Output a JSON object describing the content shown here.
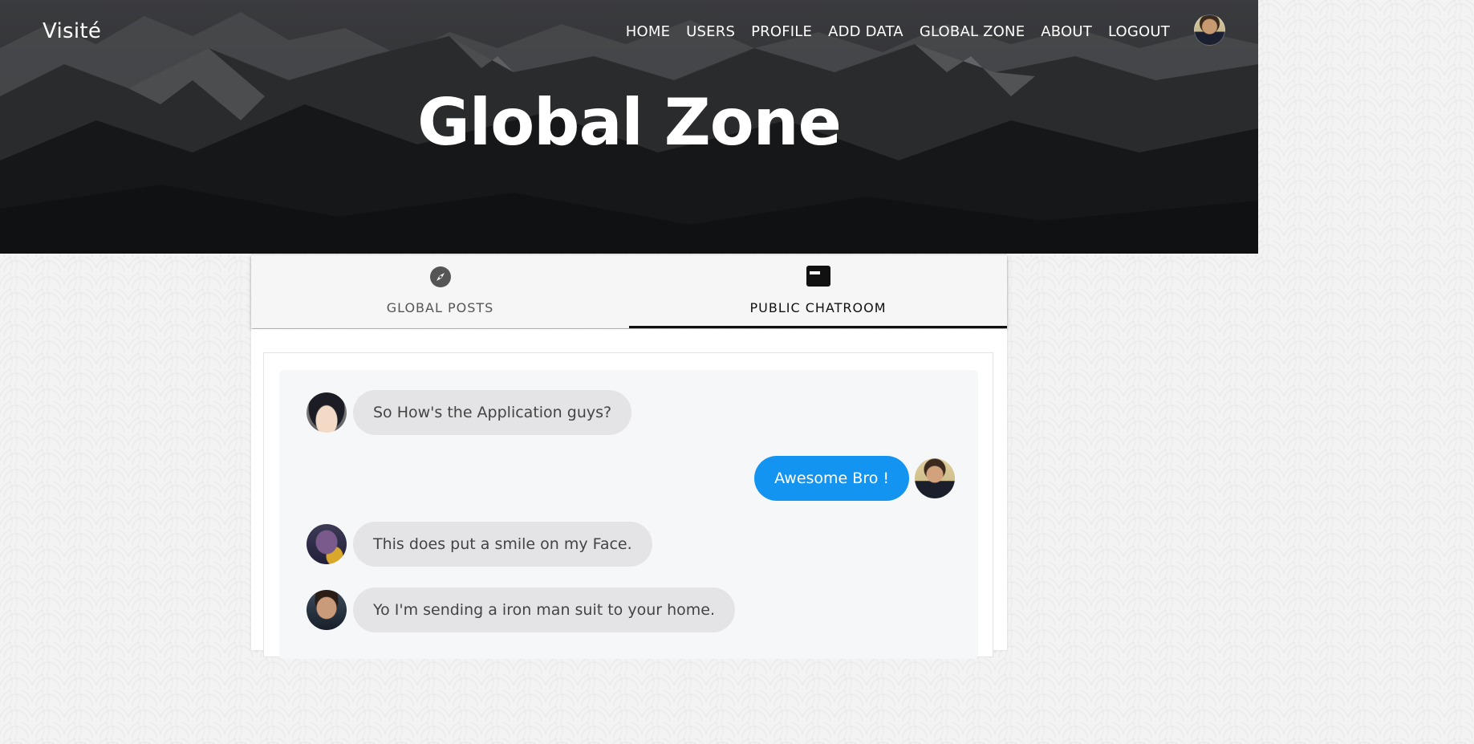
{
  "navbar": {
    "brand": "Visité",
    "links": [
      "HOME",
      "USERS",
      "PROFILE",
      "ADD DATA",
      "GLOBAL ZONE",
      "ABOUT",
      "LOGOUT"
    ],
    "avatar_icon": "user-avatar"
  },
  "hero": {
    "title": "Global Zone"
  },
  "tabs": [
    {
      "label": "GLOBAL POSTS",
      "icon": "compass-icon",
      "active": false
    },
    {
      "label": "PUBLIC CHATROOM",
      "icon": "chat-window-icon",
      "active": true
    }
  ],
  "chat": {
    "messages": [
      {
        "text": "So How's the Application guys?",
        "side": "left",
        "avatar": "anime-avatar"
      },
      {
        "text": "Awesome Bro !",
        "side": "right",
        "avatar": "self-avatar"
      },
      {
        "text": "This does put a smile on my Face.",
        "side": "left",
        "avatar": "thanos-avatar"
      },
      {
        "text": "Yo I'm sending a iron man suit to your home.",
        "side": "left",
        "avatar": "stark-avatar"
      }
    ]
  },
  "colors": {
    "accent_bubble": "#1394f0",
    "other_bubble": "#e4e4e7",
    "active_tab_underline": "#111111"
  }
}
